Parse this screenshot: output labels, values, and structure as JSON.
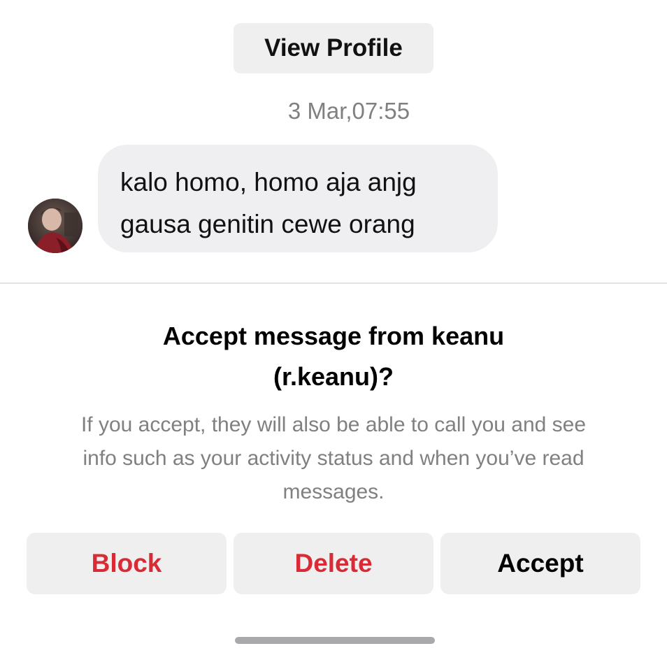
{
  "header": {
    "view_profile_label": "View Profile"
  },
  "conversation": {
    "timestamp": "3 Mar,07:55",
    "message": {
      "lines": [
        "kalo homo, homo aja anjg",
        "gausa genitin cewe orang"
      ],
      "sender_avatar_icon": "avatar-photo"
    }
  },
  "request": {
    "title_lines": [
      "Accept message from keanu",
      "(r.keanu)?"
    ],
    "description_lines": [
      "If you accept, they will also be able to call you and see",
      "info such as your activity status and when you’ve read",
      "messages."
    ],
    "actions": {
      "block_label": "Block",
      "delete_label": "Delete",
      "accept_label": "Accept"
    }
  },
  "colors": {
    "destructive": "#d92b35",
    "secondary_text": "#808080",
    "button_background": "#efefef",
    "bubble_background": "#efeff2"
  }
}
